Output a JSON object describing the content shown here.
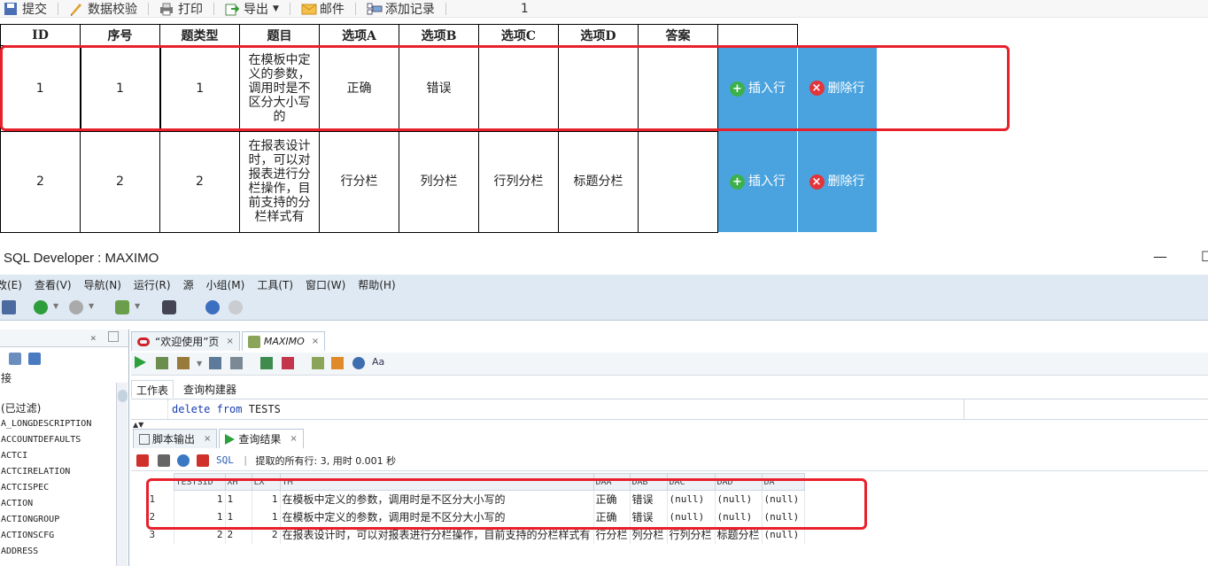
{
  "toolbar": {
    "submit": "提交",
    "validate": "数据校验",
    "print": "打印",
    "export": "导出",
    "mail": "邮件",
    "add_record": "添加记录",
    "record_count": "1"
  },
  "grid": {
    "headers": [
      "ID",
      "序号",
      "题类型",
      "题目",
      "选项A",
      "选项B",
      "选项C",
      "选项D",
      "答案"
    ],
    "rows": [
      {
        "id": "1",
        "seq": "1",
        "type": "1",
        "question": "在模板中定义的参数，调用时是不区分大小写的",
        "a": "正确",
        "b": "错误",
        "c": "",
        "d": "",
        "answer": ""
      },
      {
        "id": "2",
        "seq": "2",
        "type": "2",
        "question": "在报表设计时，可以对报表进行分栏操作，目前支持的分栏样式有",
        "a": "行分栏",
        "b": "列分栏",
        "c": "行列分栏",
        "d": "标题分栏",
        "answer": ""
      }
    ],
    "insert_label": "插入行",
    "delete_label": "删除行"
  },
  "sqldev": {
    "title": "SQL Developer : MAXIMO",
    "menu": [
      "改(E)",
      "查看(V)",
      "导航(N)",
      "运行(R)",
      "源",
      "小组(M)",
      "工具(T)",
      "窗口(W)",
      "帮助(H)"
    ],
    "tabs": [
      "“欢迎使用”页",
      "MAXIMO"
    ],
    "subtabs": [
      "工作表",
      "查询构建器"
    ],
    "sql_keyword1": "delete",
    "sql_keyword2": "from",
    "sql_table": "TESTS",
    "result_tabs": [
      "脚本输出",
      "查询结果"
    ],
    "result_sql": "SQL",
    "result_status": "提取的所有行: 3, 用时 0.001 秒",
    "left_items": [
      "A_LONGDESCRIPTION",
      "ACCOUNTDEFAULTS",
      "ACTCI",
      "ACTCIRELATION",
      "ACTCISPEC",
      "ACTION",
      "ACTIONGROUP",
      "ACTIONSCFG",
      "ADDRESS"
    ],
    "left_label_top": "接",
    "left_filtered": "(已过滤)",
    "columns": [
      "TESTSID",
      "XH",
      "LX",
      "TM",
      "DAA",
      "DAB",
      "DAC",
      "DAD",
      "DA"
    ],
    "result_rows": [
      {
        "rn": "1",
        "testsid": "1",
        "xh": "1",
        "lx": "1",
        "tm": "在模板中定义的参数，调用时是不区分大小写的",
        "daa": "正确",
        "dab": "错误",
        "dac": "(null)",
        "dad": "(null)",
        "da": "(null)"
      },
      {
        "rn": "2",
        "testsid": "1",
        "xh": "1",
        "lx": "1",
        "tm": "在模板中定义的参数，调用时是不区分大小写的",
        "daa": "正确",
        "dab": "错误",
        "dac": "(null)",
        "dad": "(null)",
        "da": "(null)"
      },
      {
        "rn": "3",
        "testsid": "2",
        "xh": "2",
        "lx": "2",
        "tm": "在报表设计时，可以对报表进行分栏操作，目前支持的分栏样式有",
        "daa": "行分栏",
        "dab": "列分栏",
        "dac": "行列分栏",
        "dad": "标题分栏",
        "da": "(null)"
      }
    ]
  },
  "colors": {
    "accent_blue": "#4aa3df",
    "highlight_red": "#e8202c",
    "insert_green": "#3cb04a",
    "delete_red": "#e3343a",
    "ide_bar": "#dfe9f3"
  }
}
